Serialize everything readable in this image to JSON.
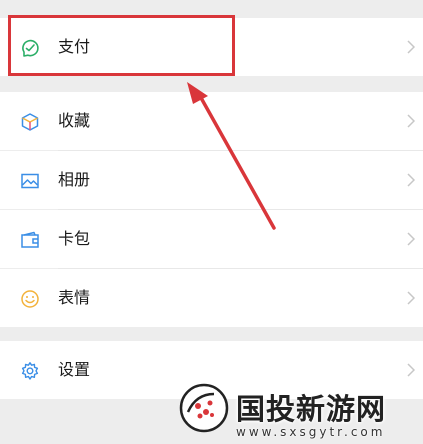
{
  "menu": {
    "pay": {
      "label": "支付",
      "icon": "pay-icon"
    },
    "favorites": {
      "label": "收藏",
      "icon": "cube-icon"
    },
    "album": {
      "label": "相册",
      "icon": "image-icon"
    },
    "cards": {
      "label": "卡包",
      "icon": "wallet-icon"
    },
    "stickers": {
      "label": "表情",
      "icon": "smiley-icon"
    },
    "settings": {
      "label": "设置",
      "icon": "gear-icon"
    }
  },
  "watermark": {
    "title": "国投新游网",
    "url": "www.sxsgytr.com"
  },
  "colors": {
    "highlight": "#d9363a",
    "pay_icon": "#2bae67",
    "favorites_icon_a": "#f3b23a",
    "favorites_icon_b": "#3a8ee6",
    "album_icon": "#3a8ee6",
    "cards_icon": "#3a8ee6",
    "stickers_icon": "#f3b23a",
    "settings_icon": "#3a8ee6"
  }
}
